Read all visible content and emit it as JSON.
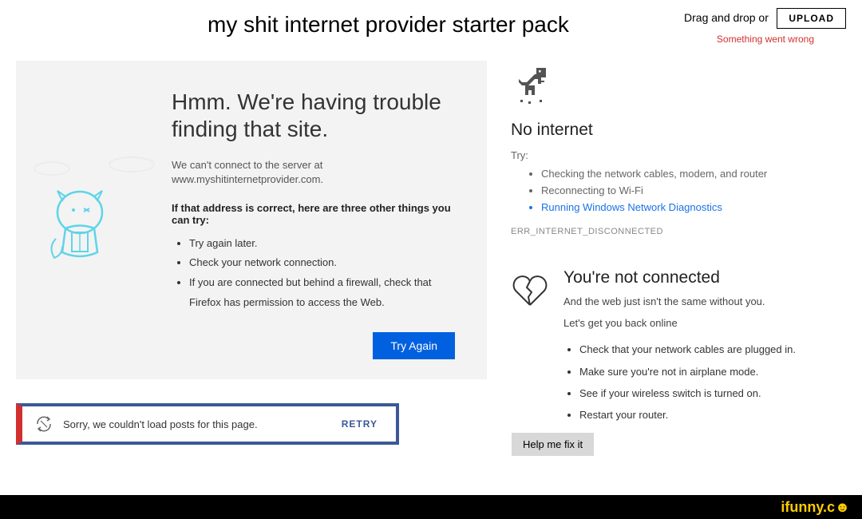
{
  "title": "my shit internet provider starter pack",
  "upload": {
    "drag_text": "Drag and drop or",
    "button": "UPLOAD",
    "error": "Something went wrong"
  },
  "firefox": {
    "title": "Hmm. We're having trouble finding that site.",
    "subtitle": "We can't connect to the server at www.myshitinternetprovider.com.",
    "instruction": "If that address is correct, here are three other things you can try:",
    "tips": [
      "Try again later.",
      "Check your network connection.",
      "If you are connected but behind a firewall, check that Firefox has permission to access the Web."
    ],
    "button": "Try Again"
  },
  "facebook": {
    "message": "Sorry, we couldn't load posts for this page.",
    "retry": "RETRY"
  },
  "chrome": {
    "title": "No internet",
    "try_label": "Try:",
    "tips": [
      "Checking the network cables, modem, and router",
      "Reconnecting to Wi-Fi",
      "Running Windows Network Diagnostics"
    ],
    "error_code": "ERR_INTERNET_DISCONNECTED"
  },
  "edge": {
    "title": "You're not connected",
    "subtitle": "And the web just isn't the same without you.",
    "prompt": "Let's get you back online",
    "tips": [
      "Check that your network cables are plugged in.",
      "Make sure you're not in airplane mode.",
      "See if your wireless switch is turned on.",
      "Restart your router."
    ],
    "button": "Help me fix it"
  },
  "watermark": "ifunny.c☻"
}
